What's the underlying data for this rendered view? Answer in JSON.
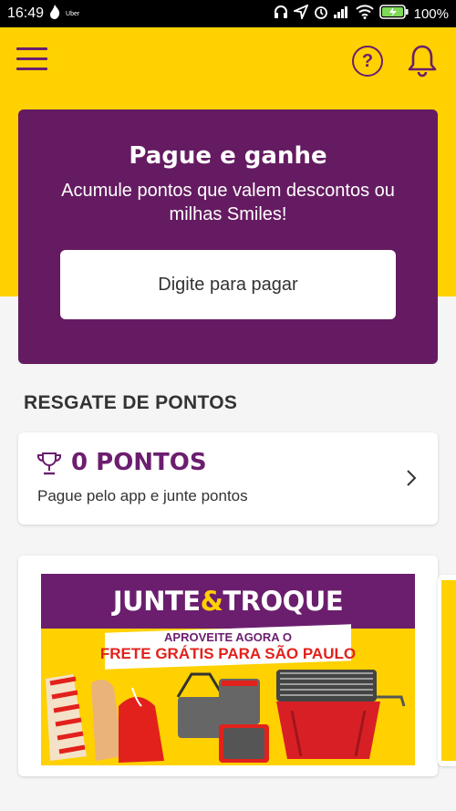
{
  "status_bar": {
    "time": "16:49",
    "uber_label": "Uber",
    "battery": "100%",
    "icons": [
      "flame-icon",
      "uber-icon",
      "headphones-icon",
      "location-icon",
      "alarm-icon",
      "signal-icon",
      "wifi-icon",
      "battery-icon"
    ]
  },
  "topbar": {
    "icons": [
      "menu-icon",
      "help-icon",
      "bell-icon"
    ],
    "help_glyph": "?"
  },
  "hero": {
    "title": "Pague e ganhe",
    "subtitle": "Acumule pontos que valem descontos ou milhas Smiles!",
    "button_label": "Digite para pagar"
  },
  "rewards": {
    "section_title": "RESGATE DE PONTOS",
    "points": "0 PONTOS",
    "description": "Pague pelo app e junte pontos"
  },
  "banner": {
    "headline_part1": "JUNTE",
    "headline_amp": "&",
    "headline_part2": "TROQUE",
    "line1": "APROVEITE AGORA O",
    "line2": "FRETE GRÁTIS PARA SÃO PAULO"
  },
  "colors": {
    "brand_yellow": "#ffd100",
    "brand_purple": "#651b61",
    "accent_red": "#e2211c"
  }
}
